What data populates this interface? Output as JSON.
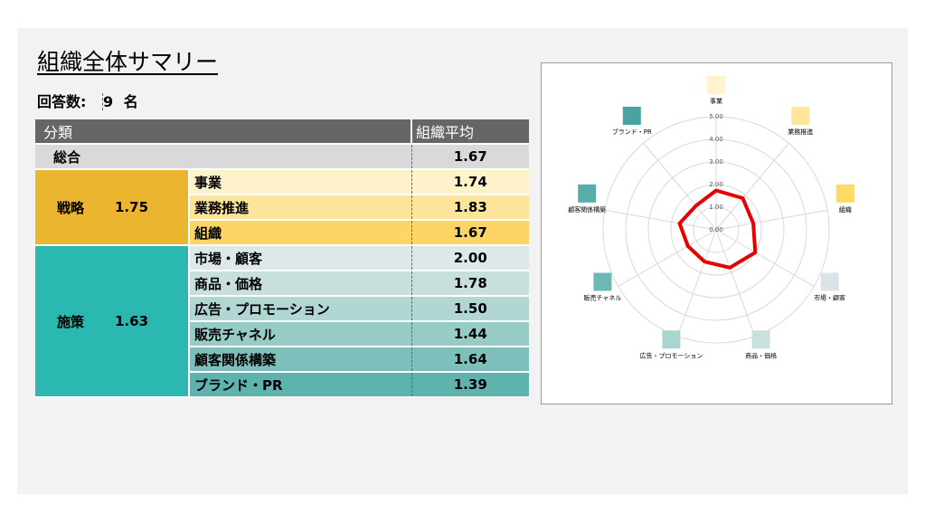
{
  "title": "組織全体サマリー",
  "respondents": {
    "label": "回答数:",
    "value": "9",
    "unit": "名"
  },
  "table": {
    "header": {
      "category": "分類",
      "avg": "組織平均"
    },
    "total": {
      "label": "総合",
      "value": "1.67"
    },
    "groups": [
      {
        "name": "戦略",
        "score": "1.75",
        "items": [
          {
            "label": "事業",
            "value": "1.74",
            "color": "#fef2cb"
          },
          {
            "label": "業務推進",
            "value": "1.83",
            "color": "#fde49b"
          },
          {
            "label": "組織",
            "value": "1.67",
            "color": "#fdd466"
          }
        ]
      },
      {
        "name": "施策",
        "score": "1.63",
        "items": [
          {
            "label": "市場・顧客",
            "value": "2.00",
            "color": "#dde8ea"
          },
          {
            "label": "商品・価格",
            "value": "1.78",
            "color": "#c9dfdd"
          },
          {
            "label": "広告・プロモーション",
            "value": "1.50",
            "color": "#b1d6d3"
          },
          {
            "label": "販売チャネル",
            "value": "1.44",
            "color": "#97cbc6"
          },
          {
            "label": "顧客関係構築",
            "value": "1.64",
            "color": "#7dbfba"
          },
          {
            "label": "ブランド・PR",
            "value": "1.39",
            "color": "#5fb3ae"
          }
        ]
      }
    ]
  },
  "chart_data": {
    "type": "radar",
    "categories": [
      "事業",
      "業務推進",
      "組織",
      "市場・顧客",
      "商品・価格",
      "広告・プロモーション",
      "販売チャネル",
      "顧客関係構築",
      "ブランド・PR"
    ],
    "values": [
      1.74,
      1.83,
      1.67,
      2.0,
      1.78,
      1.5,
      1.44,
      1.64,
      1.39
    ],
    "rlim": [
      0,
      5
    ],
    "ticks": [
      "0.00",
      "1.00",
      "2.00",
      "3.00",
      "4.00",
      "5.00"
    ],
    "legend_colors": [
      "#fff2cc",
      "#ffe699",
      "#ffd966",
      "#dae3e5",
      "#c9e0de",
      "#a9d4d1",
      "#6cb8b4",
      "#5aaca8",
      "#48a3a1"
    ],
    "line_color": "#e60000",
    "grid": true
  }
}
